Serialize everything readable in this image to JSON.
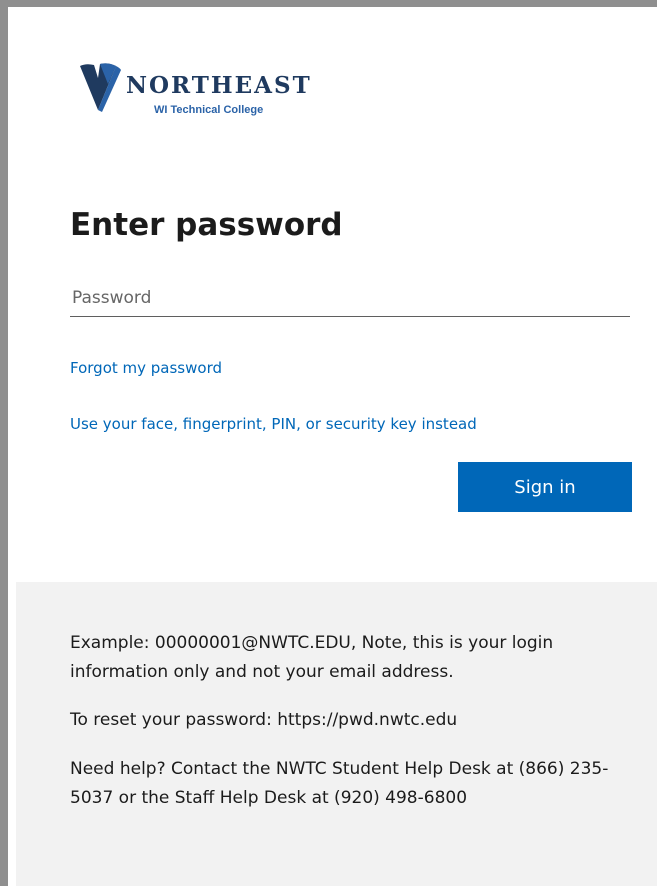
{
  "logo": {
    "name": "NORTHEAST",
    "subtitle": "WI Technical College"
  },
  "form": {
    "title": "Enter password",
    "password_placeholder": "Password",
    "password_value": "",
    "forgot_link": "Forgot my password",
    "alt_signin_link": "Use your face, fingerprint, PIN, or security key instead",
    "signin_label": "Sign in"
  },
  "footer": {
    "example_text": "Example: 00000001@NWTC.EDU, Note, this is your login information only and not your email address.",
    "reset_text": "To reset your password: https://pwd.nwtc.edu",
    "help_text": "Need help? Contact the NWTC Student Help Desk at (866) 235-5037 or the Staff Help Desk at (920) 498-6800"
  },
  "colors": {
    "accent": "#0067b8",
    "footer_bg": "#f2f2f2",
    "logo_navy": "#1f3a5f",
    "logo_blue": "#2b63a8"
  },
  "icons": {
    "logo_mark": "shield-chevron-logo"
  }
}
